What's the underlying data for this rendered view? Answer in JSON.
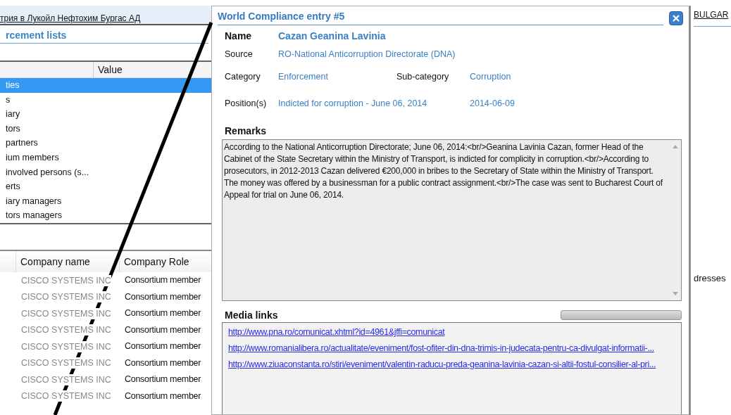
{
  "background_window": {
    "top_row": "трия в Лукойл Нефтохим Бургас АД",
    "section_title": "rcement lists",
    "list_columns": [
      "Value"
    ],
    "list_items": [
      {
        "label": "ties",
        "selected": true
      },
      {
        "label": "s",
        "selected": false
      },
      {
        "label": "iary",
        "selected": false
      },
      {
        "label": "tors",
        "selected": false
      },
      {
        "label": "partners",
        "selected": false
      },
      {
        "label": "ium members",
        "selected": false
      },
      {
        "label": "involved persons (s...",
        "selected": false
      },
      {
        "label": "erts",
        "selected": false
      },
      {
        "label": "iary managers",
        "selected": false
      },
      {
        "label": "tors managers",
        "selected": false
      }
    ],
    "table": {
      "columns": [
        "Company name",
        "Company Role"
      ],
      "rows": [
        [
          "CISCO SYSTEMS INC",
          "Consortium member"
        ],
        [
          "CISCO SYSTEMS INC",
          "Consortium member"
        ],
        [
          "CISCO SYSTEMS INC",
          "Consortium member"
        ],
        [
          "CISCO SYSTEMS INC",
          "Consortium member"
        ],
        [
          "CISCO SYSTEMS INC",
          "Consortium member"
        ],
        [
          "CISCO SYSTEMS INC",
          "Consortium member"
        ],
        [
          "CISCO SYSTEMS INC",
          "Consortium member"
        ],
        [
          "CISCO SYSTEMS INC",
          "Consortium member"
        ]
      ]
    },
    "right_top": "BULGAR",
    "right_cell": "dresses"
  },
  "dialog": {
    "title": "World Compliance entry #5",
    "name_label": "Name",
    "name": "Cazan Geanina Lavinia",
    "source_label": "Source",
    "source": "RO-National Anticorruption Directorate (DNA)",
    "category_label": "Category",
    "category": "Enforcement",
    "subcategory_label": "Sub-category",
    "subcategory": "Corruption",
    "positions_label": "Position(s)",
    "position": "Indicted for corruption - June 06, 2014",
    "position_date": "2014-06-09",
    "remarks_label": "Remarks",
    "remarks": "According to the National Anticorruption Directorate; June 06, 2014:<br/>Geanina Lavinia Cazan, former Head of the Cabinet of the State Secretary within the Ministry of Transport, is indicted for complicity in corruption.<br/>According to prosecutors, in 2012-2013 Cazan delivered €200,000 in bribes to the Secretary of State within the Ministry of Transport. The money was offered by a businessman for a public contract assignment.<br/>The case was sent to Bucharest Court of Appeal for trial on June 06, 2014.",
    "media_label": "Media links",
    "media_progress": {
      "level": 0
    },
    "links": [
      "http://www.pna.ro/comunicat.xhtml?id=4961&jffi=comunicat",
      "http://www.romanialibera.ro/actualitate/eveniment/fost-ofiter-din-dna-trimis-in-judecata-pentru-ca-divulgat-informatii-...",
      "http://www.ziuaconstanta.ro/stiri/eveniment/valentin-raducu-preda-geanina-lavinia-cazan-si-altii-fostul-consilier-al-pri..."
    ]
  }
}
